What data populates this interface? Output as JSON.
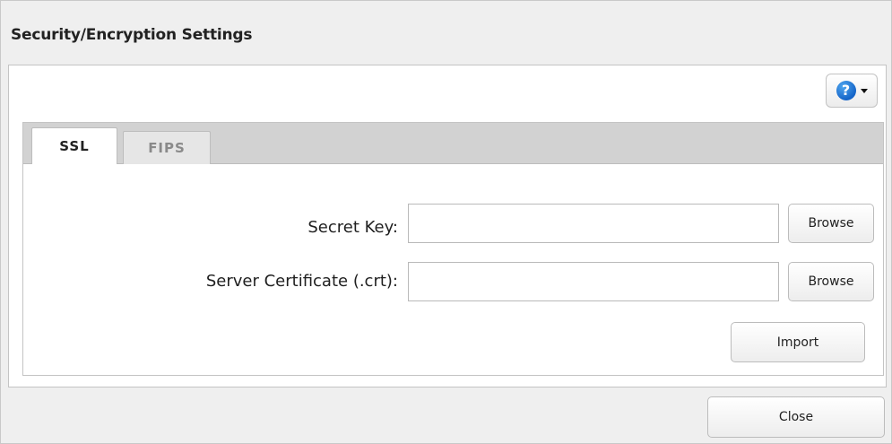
{
  "dialog": {
    "title": "Security/Encryption Settings",
    "close_label": "Close"
  },
  "help": {
    "icon": "help-icon",
    "glyph": "?"
  },
  "tabs": [
    {
      "label": "SSL",
      "active": true
    },
    {
      "label": "FIPS",
      "active": false
    }
  ],
  "ssl": {
    "secret_key_label": "Secret Key:",
    "secret_key_value": "",
    "server_cert_label": "Server Certificate (.crt):",
    "server_cert_value": "",
    "browse_label": "Browse",
    "import_label": "Import"
  },
  "colors": {
    "help_accent": "#1e78d8",
    "dialog_bg": "#efefef",
    "tab_bar_bg": "#d2d2d2"
  }
}
